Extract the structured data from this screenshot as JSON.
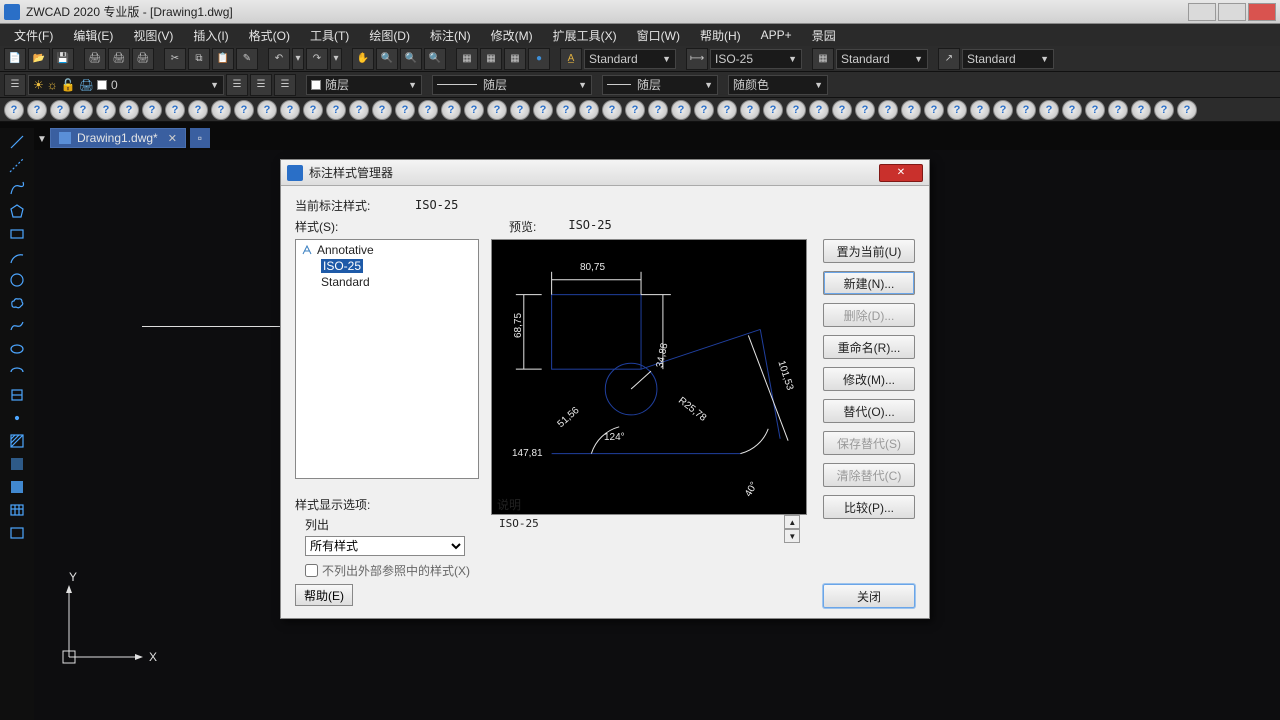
{
  "titlebar": {
    "text": "ZWCAD 2020 专业版 - [Drawing1.dwg]"
  },
  "menu": {
    "items": [
      "文件(F)",
      "编辑(E)",
      "视图(V)",
      "插入(I)",
      "格式(O)",
      "工具(T)",
      "绘图(D)",
      "标注(N)",
      "修改(M)",
      "扩展工具(X)",
      "窗口(W)",
      "帮助(H)",
      "APP+",
      "景园"
    ]
  },
  "toolbar1": {
    "text_style": "Standard",
    "dim_style": "ISO-25",
    "table_style": "Standard",
    "ml_style": "Standard"
  },
  "toolbar2": {
    "layer": "0",
    "linetype": "随层",
    "lineweight": "随层",
    "linestyle": "随层",
    "color": "随颜色"
  },
  "doc_tab": {
    "name": "Drawing1.dwg*"
  },
  "dialog": {
    "title": "标注样式管理器",
    "current_label": "当前标注样式:",
    "current_value": "ISO-25",
    "styles_label": "样式(S):",
    "preview_label": "预览:",
    "preview_value": "ISO-25",
    "styles": {
      "annotative": "Annotative",
      "iso25": "ISO-25",
      "standard": "Standard"
    },
    "preview_dims": {
      "d1": "80,75",
      "d2": "68,75",
      "d3": "34,88",
      "d4": "101,53",
      "d5": "R25,78",
      "d6": "51,56",
      "d7": "124°",
      "d8": "147,81",
      "d9": "40°"
    },
    "display_options_label": "样式显示选项:",
    "list_label": "列出",
    "list_value": "所有样式",
    "checkbox_label": "不列出外部参照中的样式(X)",
    "desc_label": "说明",
    "desc_value": "ISO-25",
    "buttons": {
      "set_current": "置为当前(U)",
      "new": "新建(N)...",
      "delete": "删除(D)...",
      "rename": "重命名(R)...",
      "modify": "修改(M)...",
      "override": "替代(O)...",
      "save_override": "保存替代(S)",
      "clear_override": "清除替代(C)",
      "compare": "比较(P)..."
    },
    "help_btn": "帮助(E)",
    "close_btn": "关闭"
  },
  "ucs": {
    "x": "X",
    "y": "Y"
  }
}
